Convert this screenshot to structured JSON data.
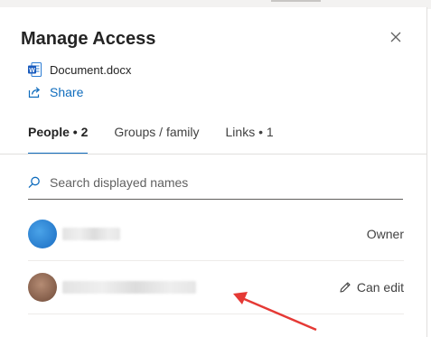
{
  "dialog": {
    "title": "Manage Access",
    "document": {
      "name": "Document.docx",
      "icon": "word-doc-icon"
    },
    "share_label": "Share",
    "tabs": [
      {
        "label": "People • 2",
        "active": true
      },
      {
        "label": "Groups / family",
        "active": false
      },
      {
        "label": "Links • 1",
        "active": false
      }
    ],
    "search": {
      "placeholder": "Search displayed names",
      "value": ""
    },
    "people": [
      {
        "name_hidden": true,
        "role": "Owner"
      },
      {
        "name_hidden": true,
        "role": "Can edit",
        "role_icon": "pencil-icon"
      }
    ]
  },
  "colors": {
    "accent": "#0f6cbd",
    "annotation_arrow": "#e53935",
    "word_blue": "#185abd"
  }
}
